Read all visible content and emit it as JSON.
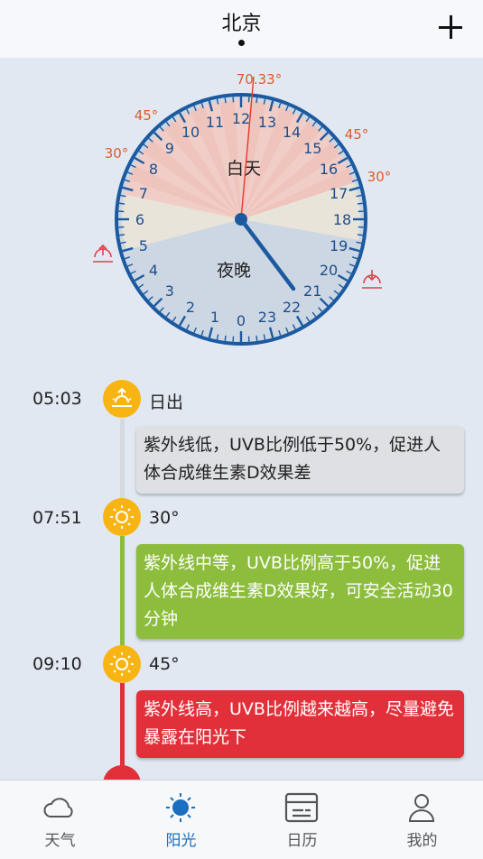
{
  "header": {
    "title": "北京"
  },
  "dial": {
    "sun_angle_label": "70.33°",
    "left_labels": {
      "upper": "45°",
      "lower": "30°"
    },
    "right_labels": {
      "upper": "45°",
      "lower": "30°"
    },
    "day_label": "白天",
    "night_label": "夜晚",
    "hours": [
      "0",
      "1",
      "2",
      "3",
      "4",
      "5",
      "6",
      "7",
      "8",
      "9",
      "10",
      "11",
      "12",
      "13",
      "14",
      "15",
      "16",
      "17",
      "18",
      "19",
      "20",
      "21",
      "22",
      "23"
    ],
    "colors": {
      "noon_zone": "#efc4bd",
      "mid_zone": "#e9e4d9",
      "night_zone": "#cdd7e3",
      "ring": "#1c5aa0",
      "accent": "#e05a2b"
    }
  },
  "timeline": [
    {
      "time": "05:03",
      "label": "日出",
      "icon": "sunrise-icon",
      "card": "紫外线低，UVB比例低于50%，促进人体合成维生素D效果差",
      "card_color": "gray"
    },
    {
      "time": "07:51",
      "label": "30°",
      "icon": "sun-icon",
      "card": "紫外线中等，UVB比例高于50%，促进人体合成维生素D效果好，可安全活动30分钟",
      "card_color": "green"
    },
    {
      "time": "09:10",
      "label": "45°",
      "icon": "sun-icon",
      "card": "紫外线高，UVB比例越来越高，尽量避免暴露在阳光下",
      "card_color": "red"
    }
  ],
  "nav": [
    {
      "label": "天气",
      "icon": "cloud-icon",
      "active": false
    },
    {
      "label": "阳光",
      "icon": "sun-icon",
      "active": true
    },
    {
      "label": "日历",
      "icon": "calendar-icon",
      "active": false
    },
    {
      "label": "我的",
      "icon": "profile-icon",
      "active": false
    }
  ]
}
